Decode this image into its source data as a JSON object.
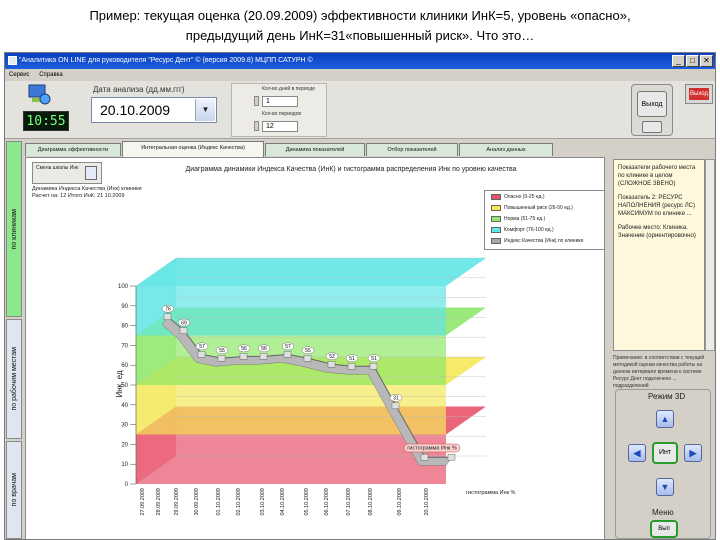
{
  "caption": {
    "line1": "Пример: текущая оценка (20.09.2009) эффективности клиники ИнК=5, уровень «опасно»,",
    "line2": "предыдущий день ИнК=31«повышенный риск». Что это…"
  },
  "window": {
    "title": "\"Аналитика ON LINE для руководителя \"Ресурс Дент\" © (версия 2009.8)  МЦПП САТУРН ©",
    "menu": [
      "Сервис",
      "Справка"
    ],
    "controls": [
      "_",
      "□",
      "✕"
    ]
  },
  "toolbar": {
    "clock": "10:55",
    "date_label": "Дата анализа (дд.мм.ггг)",
    "date_value": "20.10.2009",
    "date_dropdown": "▼",
    "param1_label": "Кол-во дней в периоде",
    "param1_value": "1",
    "param2_label": "Кол-во периодов",
    "param2_value": "12",
    "exit_label": "Выход",
    "close_label": "Выход"
  },
  "left_tabs": [
    "по клиникам",
    "по рабочим местам",
    "по врачам"
  ],
  "tabs": [
    {
      "label": "Диаграмма эффективности"
    },
    {
      "label": "Интегральная оценка (Индекс Качества)"
    },
    {
      "label": "Динамика показателей"
    },
    {
      "label": "Отбор показателей"
    },
    {
      "label": "Анализ данных"
    }
  ],
  "panel": {
    "button_label": "Смена шкалы Инк",
    "heading": "Диаграмма динамики Индекса Качества (ИнК) и гистограмма распределения Инк по уровню качества",
    "sub1": "Динамика Индекса Качества (Инк) клиники",
    "sub2": "Расчет на: 12 Итого ИнК: 21 10.2009"
  },
  "legend": [
    {
      "label": "Опасно (0-25 ед.)",
      "color": "#e8536b"
    },
    {
      "label": "Повышенный риск (26-50 ед.)",
      "color": "#f4e85a"
    },
    {
      "label": "Норма (51-75 ед.)",
      "color": "#8ee86a"
    },
    {
      "label": "Комфорт (76-100 ед.)",
      "color": "#62e6e6"
    },
    {
      "label": "Индекс Качества (Инк) по клинике",
      "color": "#a8a8a8"
    }
  ],
  "info": {
    "header": "Показатели рабочего места по клинике в целом (СЛОЖНОЕ ЗВЕНО)",
    "body": "Показатель 2: РЕСУРС НАПОЛНЕНИЯ (ресурс ЛС) МАКСИМУМ по клинике ...",
    "body2": "Рабочее место: Клиника. Значение (ориентировочно)",
    "note": "Примечание: в соответствии с текущей методикой оценки качества работы на данном интервале времени к системе Ресурс Дент подключено ... подразделений"
  },
  "nav": {
    "mode_label": "Режим 3D",
    "center_label": "Инт",
    "menu_label": "Меню",
    "exit_label": "Вып"
  },
  "chart_data": {
    "type": "line",
    "title": "Динамика Индекса Качества (Инк) клиники",
    "ylabel": "Инк, ед",
    "xlabel": "гистограмма Инк %",
    "ylim": [
      0,
      100
    ],
    "yticks": [
      0,
      10,
      20,
      30,
      40,
      50,
      60,
      70,
      80,
      90,
      100
    ],
    "bands": [
      {
        "name": "Опасно",
        "from": 0,
        "to": 25,
        "color": "#e8536b"
      },
      {
        "name": "Повышенный риск",
        "from": 25,
        "to": 50,
        "color": "#f4e85a"
      },
      {
        "name": "Норма",
        "from": 50,
        "to": 75,
        "color": "#8ee86a"
      },
      {
        "name": "Комфорт",
        "from": 75,
        "to": 100,
        "color": "#62e6e6"
      }
    ],
    "categories": [
      "27.09.2009",
      "28.09.2009",
      "29.09.2009",
      "30.09.2009",
      "01.10.2009",
      "02.10.2009",
      "03.10.2009",
      "04.10.2009",
      "05.10.2009",
      "06.10.2009",
      "07.10.2009",
      "08.10.2009",
      "09.10.2009",
      "20.10.2009"
    ],
    "series": [
      {
        "name": "Индекс Качества (Инк) по клинике",
        "values": [
          76,
          69,
          57,
          55,
          56,
          56,
          57,
          55,
          52,
          51,
          51,
          31,
          5,
          5
        ]
      }
    ],
    "point_labels": [
      "76",
      "69",
      "57",
      "55",
      "56",
      "56",
      "57",
      "55",
      "52",
      "51",
      "51",
      "31",
      "5"
    ],
    "histogram_label": "гистограмма Инк %"
  }
}
